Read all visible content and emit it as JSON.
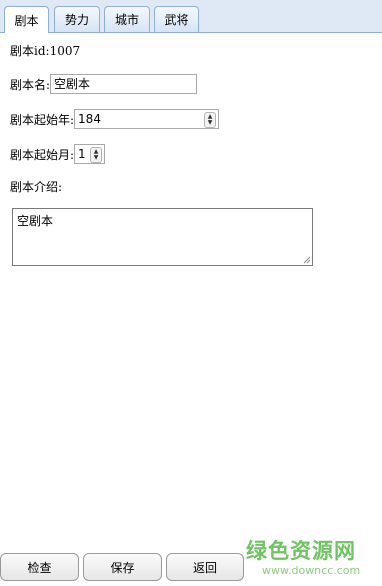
{
  "tabs": [
    {
      "label": "剧本",
      "active": true
    },
    {
      "label": "势力",
      "active": false
    },
    {
      "label": "城市",
      "active": false
    },
    {
      "label": "武将",
      "active": false
    }
  ],
  "form": {
    "script_id_label": "剧本id:",
    "script_id_value": "1007",
    "name_label": "剧本名:",
    "name_value": "空剧本",
    "start_year_label": "剧本起始年:",
    "start_year_value": "184",
    "start_month_label": "剧本起始月:",
    "start_month_value": "1",
    "intro_label": "剧本介绍:",
    "intro_value": "空剧本"
  },
  "buttons": {
    "check": "检查",
    "save": "保存",
    "back": "返回"
  },
  "watermark": {
    "main": "绿色资源网",
    "sub": "www.downcc.com"
  },
  "colors": {
    "tab_bg": "#dfe9f5",
    "tab_border": "#8fb0d6",
    "watermark": "#58b947"
  }
}
